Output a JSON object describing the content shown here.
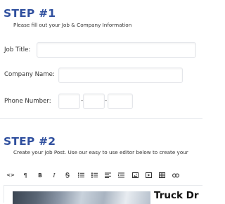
{
  "step1": {
    "title": "STEP #1",
    "subtitle": "Please fill out your Job & Company Information",
    "fields": {
      "job_title": {
        "label": "Job Title:",
        "value": ""
      },
      "company_name": {
        "label": "Company Name:",
        "value": ""
      },
      "phone": {
        "label": "Phone Number:",
        "area": "",
        "prefix": "",
        "line": "",
        "separator": "-"
      }
    }
  },
  "step2": {
    "title": "STEP #2",
    "subtitle": "Create your job Post. Use our easy to use editor below to create your"
  },
  "editor": {
    "toolbar": [
      {
        "name": "code-view-icon",
        "glyph": "<>"
      },
      {
        "name": "paragraph-icon",
        "glyph": "¶"
      },
      {
        "name": "bold-icon",
        "glyph": "B"
      },
      {
        "name": "italic-icon",
        "glyph": "I"
      },
      {
        "name": "strikethrough-icon",
        "glyph": "S"
      },
      {
        "name": "bullet-list-icon",
        "glyph": ""
      },
      {
        "name": "numbered-list-icon",
        "glyph": ""
      },
      {
        "name": "align-icon",
        "glyph": ""
      },
      {
        "name": "indent-icon",
        "glyph": ""
      },
      {
        "name": "image-icon",
        "glyph": ""
      },
      {
        "name": "video-icon",
        "glyph": ""
      },
      {
        "name": "table-icon",
        "glyph": ""
      },
      {
        "name": "link-icon",
        "glyph": ""
      }
    ],
    "content_heading": "Truck Dr"
  }
}
